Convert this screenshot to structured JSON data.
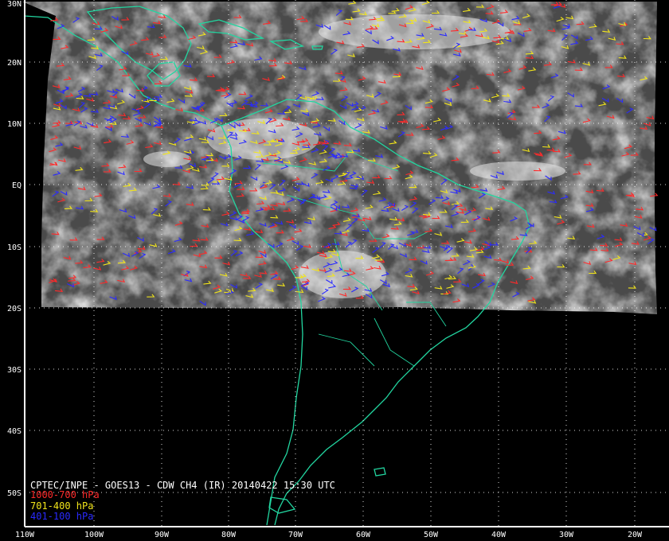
{
  "title": "CPTEC/INPE - GOES13 - CDW CH4 (IR) 20140422 15:30 UTC",
  "legend": [
    {
      "label": "1000-700 hPa",
      "color": "#ff2a2a"
    },
    {
      "label": "701-400 hPa",
      "color": "#f2e51a"
    },
    {
      "label": "401-100 hPa",
      "color": "#2a2aff"
    }
  ],
  "latitude_labels": [
    "30N",
    "20N",
    "10N",
    "EQ",
    "10S",
    "20S",
    "30S",
    "40S",
    "50S"
  ],
  "longitude_labels": [
    "110W",
    "100W",
    "90W",
    "80W",
    "70W",
    "60W",
    "50W",
    "40W",
    "30W",
    "20W"
  ],
  "colors": {
    "background": "#000000",
    "coastline": "#22d6a0",
    "grid": "#ffffff",
    "image_gray": "#4a4a4a"
  }
}
